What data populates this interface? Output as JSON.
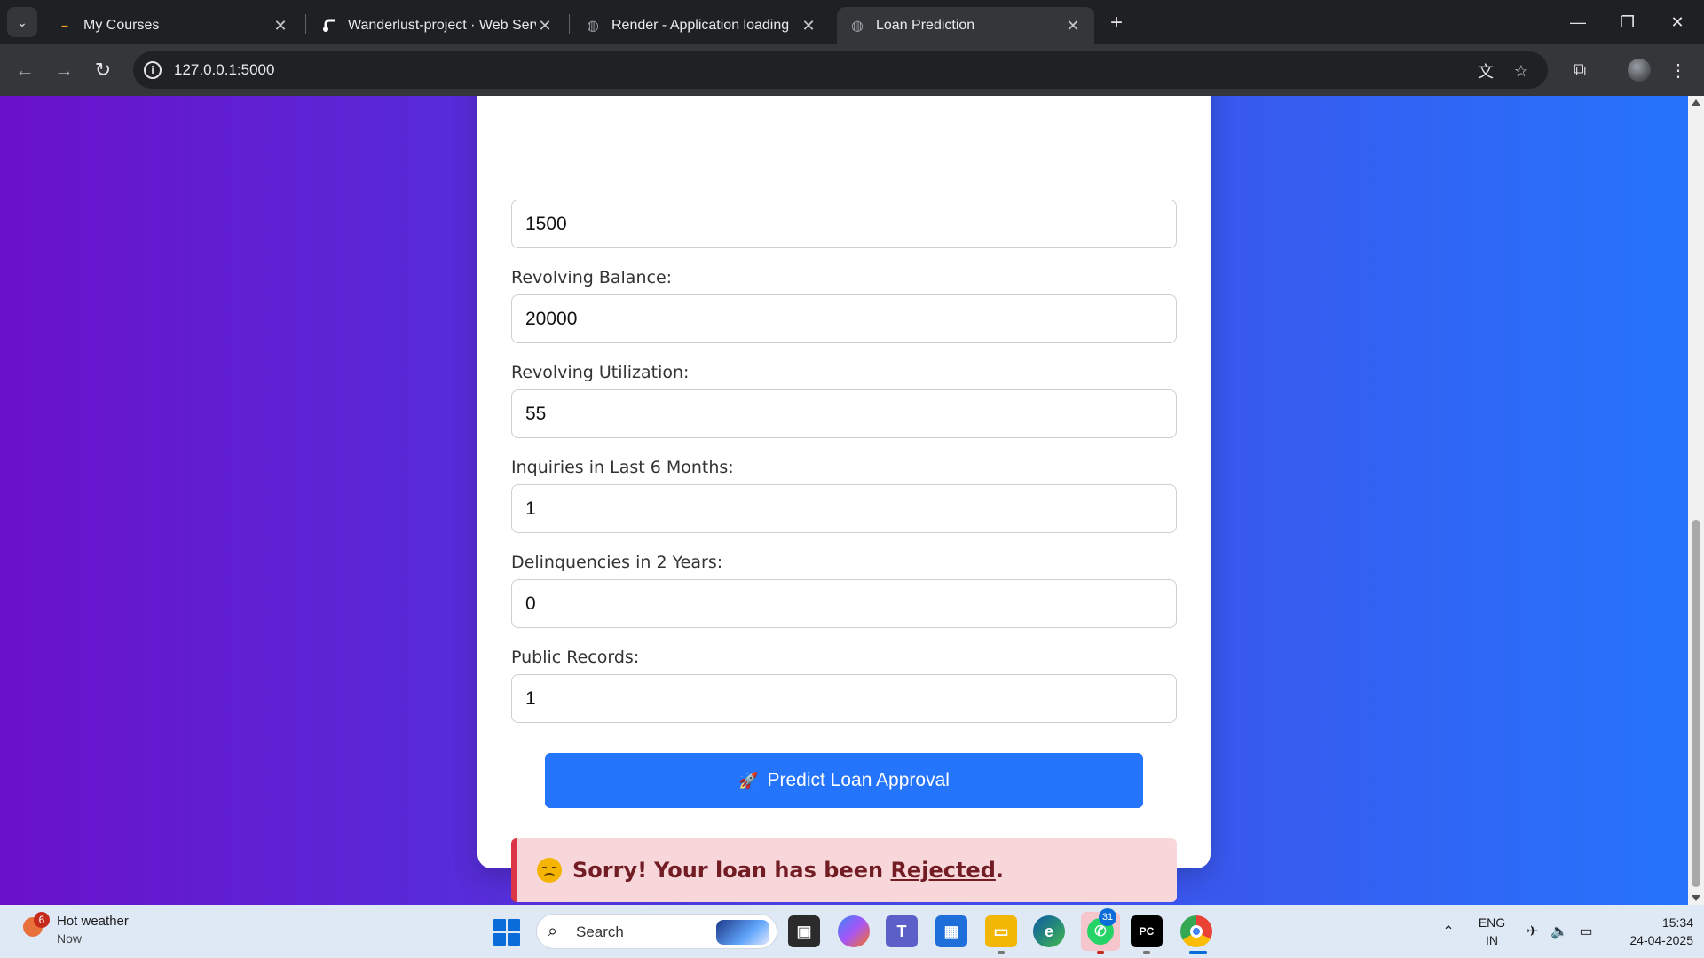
{
  "browser": {
    "tabs": [
      {
        "title": "My Courses",
        "active": false
      },
      {
        "title": "Wanderlust-project · Web Serv",
        "active": false
      },
      {
        "title": "Render - Application loading",
        "active": false
      },
      {
        "title": "Loan Prediction",
        "active": true
      }
    ],
    "url": "127.0.0.1:5000"
  },
  "form": {
    "first_value": "1500",
    "fields": [
      {
        "label": "Revolving Balance:",
        "value": "20000"
      },
      {
        "label": "Revolving Utilization:",
        "value": "55"
      },
      {
        "label": "Inquiries in Last 6 Months:",
        "value": "1"
      },
      {
        "label": "Delinquencies in 2 Years:",
        "value": "0"
      },
      {
        "label": "Public Records:",
        "value": "1"
      }
    ],
    "submit_label": "Predict Loan Approval",
    "submit_icon": "rocket-icon"
  },
  "result": {
    "lead": "Sorry!",
    "message": "Your loan has been",
    "status": "Rejected",
    "end": ".",
    "icon": "disappointed-face-icon",
    "colors": {
      "background": "#f8d7da",
      "border": "#dc3545",
      "text": "#721c24"
    }
  },
  "theme": {
    "gradient_start": "#6a11cb",
    "gradient_end": "#2575fc",
    "button": "#2575fc"
  },
  "taskbar": {
    "weather_title": "Hot weather",
    "weather_sub": "Now",
    "weather_badge": "6",
    "search_placeholder": "Search",
    "whatsapp_badge": "31",
    "lang_top": "ENG",
    "lang_bottom": "IN",
    "time": "15:34",
    "date": "24-04-2025"
  }
}
